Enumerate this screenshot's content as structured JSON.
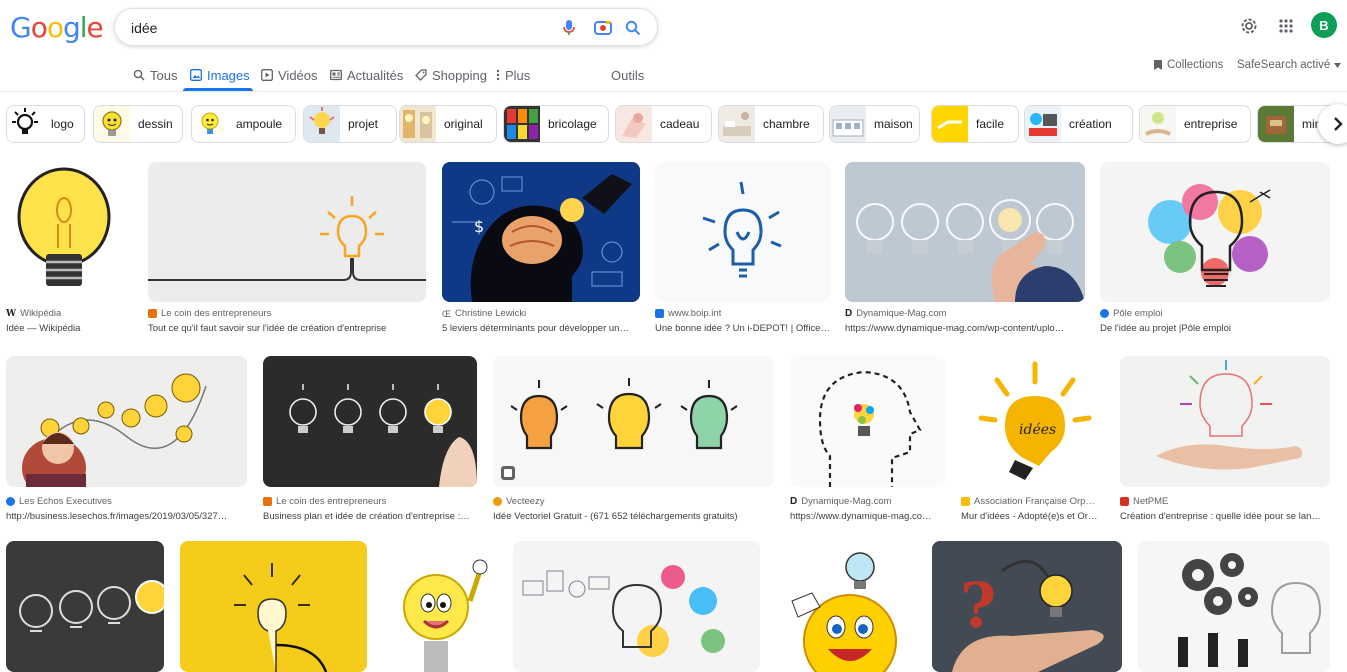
{
  "logo": {
    "text": "Google"
  },
  "search": {
    "query": "idée"
  },
  "icons": {
    "mic": "microphone-icon",
    "lens": "camera-lens-icon",
    "search": "search-icon",
    "settings": "gear-icon",
    "apps": "apps-grid-icon",
    "chevron": "chevron-right-icon"
  },
  "account": {
    "initial": "B",
    "color": "#0f9d58"
  },
  "tabs": [
    {
      "label": "Tous",
      "icon": "search-icon"
    },
    {
      "label": "Images",
      "icon": "image-icon",
      "active": true
    },
    {
      "label": "Vidéos",
      "icon": "video-icon"
    },
    {
      "label": "Actualités",
      "icon": "news-icon"
    },
    {
      "label": "Shopping",
      "icon": "tag-icon"
    },
    {
      "label": "Plus",
      "icon": "more-vertical-icon"
    }
  ],
  "tools_label": "Outils",
  "collections_label": "Collections",
  "safesearch_label": "SafeSearch activé",
  "chips": [
    "logo",
    "dessin",
    "ampoule",
    "projet",
    "original",
    "bricolage",
    "cadeau",
    "chambre",
    "maison",
    "facile",
    "création",
    "entreprise",
    "min"
  ],
  "results": [
    {
      "source": "Wikipédia",
      "title": "Idée — Wikipédia",
      "fav": "#202124"
    },
    {
      "source": "Le coin des entrepreneurs",
      "title": "Tout ce qu'il faut savoir sur l'idée de création d'entreprise",
      "fav": "#e8710a"
    },
    {
      "source": "Christine Lewicki",
      "title": "5 leviers déterminants pour développer un…",
      "fav": "#5f6368"
    },
    {
      "source": "www.boip.int",
      "title": "Une bonne idée ? Un i-DEPOT! | Office…",
      "fav": "#1a73e8"
    },
    {
      "source": "Dynamique-Mag.com",
      "title": "https://www.dynamique-mag.com/wp-content/uplo…",
      "fav": "#202124"
    },
    {
      "source": "Pôle emploi",
      "title": "De l'idée au projet |Pôle emploi",
      "fav": "#1a73e8"
    },
    {
      "source": "Les Echos Executives",
      "title": "http://business.lesechos.fr/images/2019/03/05/327…",
      "fav": "#1a73e8"
    },
    {
      "source": "Le coin des entrepreneurs",
      "title": "Business plan et idée de création d'entreprise :…",
      "fav": "#e8710a"
    },
    {
      "source": "Vecteezy",
      "title": "Idée Vectoriel Gratuit - (671 652 téléchargements gratuits)",
      "fav": "#f29900"
    },
    {
      "source": "Dynamique-Mag.com",
      "title": "https://www.dynamique-mag.co…",
      "fav": "#202124"
    },
    {
      "source": "Association Française Orp…",
      "title": "Mur d'idées - Adopté(e)s et Or…",
      "fav": "#fbbc04"
    },
    {
      "source": "NetPME",
      "title": "Création d'entreprise : quelle idée pour se lan…",
      "fav": "#d93025"
    }
  ]
}
